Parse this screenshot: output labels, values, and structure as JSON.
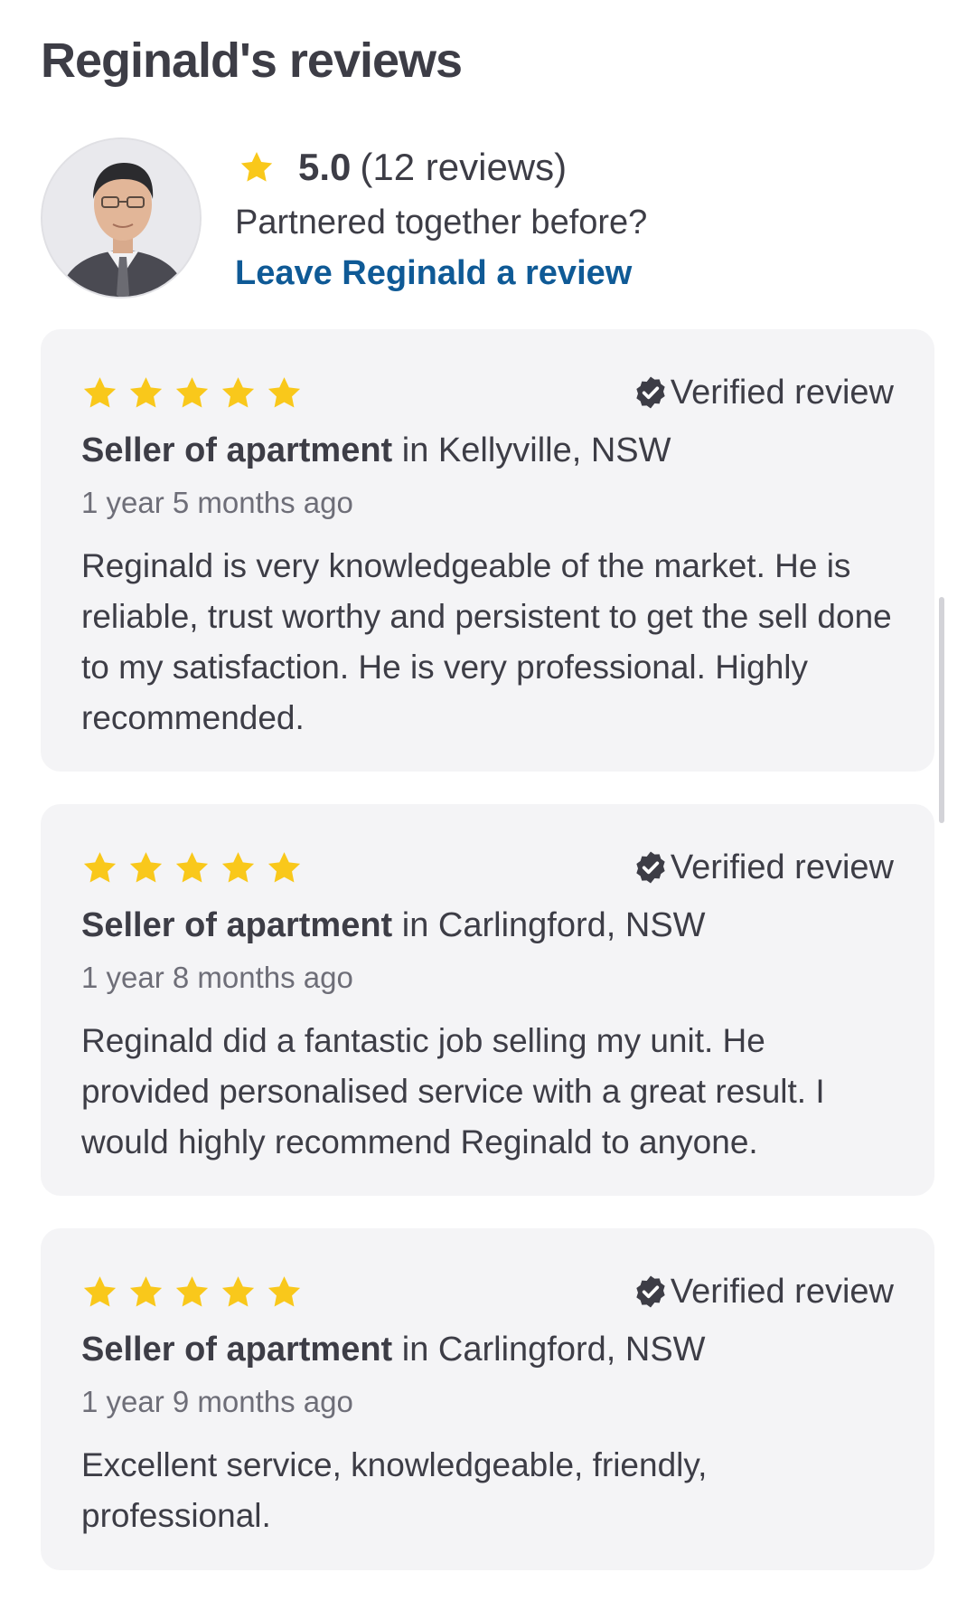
{
  "header": {
    "title": "Reginald's reviews"
  },
  "summary": {
    "rating": "5.0",
    "review_count": "(12 reviews)",
    "prompt": "Partnered together before?",
    "leave_review_link": "Leave Reginald a review",
    "star_color": "#f9c81b",
    "link_color": "#0f5a96"
  },
  "reviews": [
    {
      "stars": 5,
      "verified_label": "Verified review",
      "role": "Seller of apartment",
      "location": "in Kellyville, NSW",
      "date": "1 year 5 months ago",
      "text": "Reginald is very knowledgeable of the market. He is reliable, trust worthy and persistent to get the sell done to my satisfaction. He is very professional. Highly recommended."
    },
    {
      "stars": 5,
      "verified_label": "Verified review",
      "role": "Seller of apartment",
      "location": "in Carlingford, NSW",
      "date": "1 year 8 months ago",
      "text": "Reginald did a fantastic job selling my unit. He provided personalised service with a great result. I would highly recommend Reginald to anyone."
    },
    {
      "stars": 5,
      "verified_label": "Verified review",
      "role": "Seller of apartment",
      "location": "in Carlingford, NSW",
      "date": "1 year 9 months ago",
      "text": "Excellent service, knowledgeable, friendly, professional."
    }
  ]
}
